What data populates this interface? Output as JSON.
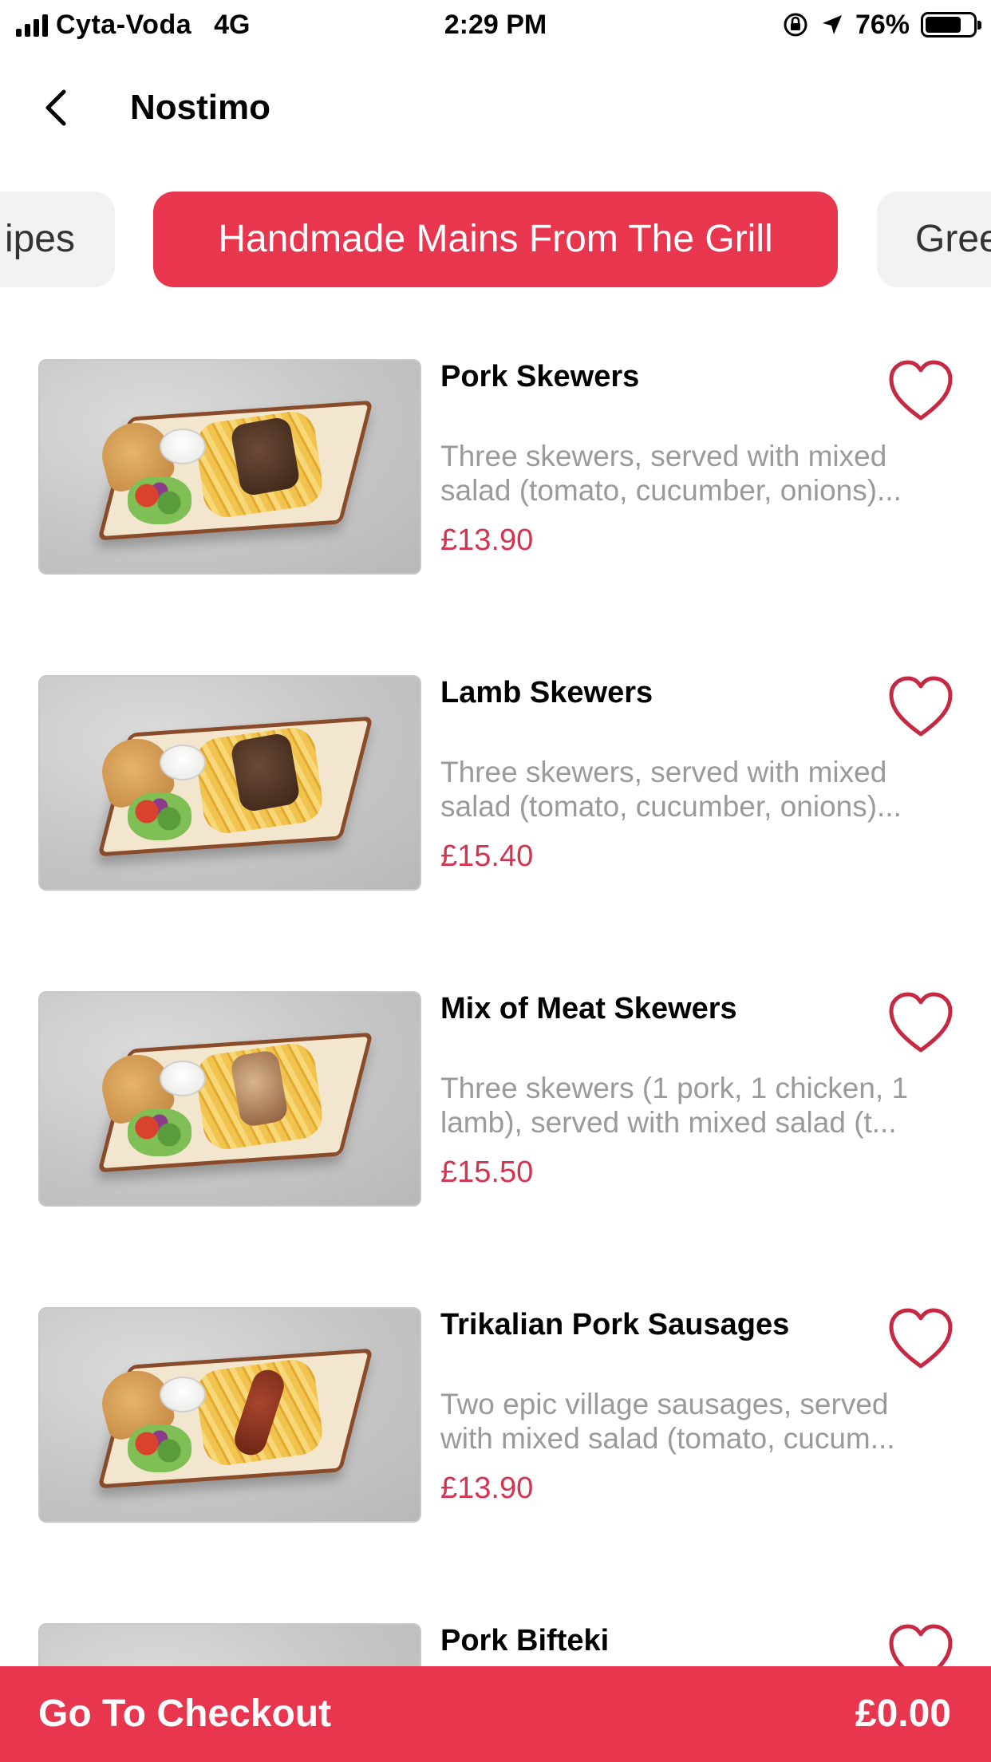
{
  "status_bar": {
    "carrier": "Cyta-Voda",
    "network": "4G",
    "time": "2:29 PM",
    "battery": "76%",
    "battery_level": 0.76
  },
  "header": {
    "title": "Nostimo",
    "back_icon": "chevron-left-icon"
  },
  "categories": {
    "previous_partial": "ipes",
    "active": "Handmade Mains From The Grill",
    "next_partial": "Gree",
    "active_color": "#e8364e"
  },
  "items": [
    {
      "name": "Pork Skewers",
      "desc_line1": "Three skewers, served with mixed",
      "desc_line2": "salad (tomato, cucumber, onions)...",
      "price": "£13.90"
    },
    {
      "name": "Lamb Skewers",
      "desc_line1": "Three skewers, served with mixed",
      "desc_line2": "salad (tomato, cucumber, onions)...",
      "price": "£15.40"
    },
    {
      "name": "Mix of Meat Skewers",
      "desc_line1": "Three skewers (1 pork, 1 chicken, 1",
      "desc_line2": "lamb), served with mixed salad (t...",
      "price": "£15.50"
    },
    {
      "name": "Trikalian Pork Sausages",
      "desc_line1": "Two epic village sausages, served",
      "desc_line2": "with mixed salad (tomato, cucum...",
      "price": "£13.90"
    },
    {
      "name": "Pork Bifteki",
      "desc_line1": "",
      "desc_line2": "",
      "price": ""
    }
  ],
  "checkout": {
    "label": "Go To Checkout",
    "total": "£0.00",
    "color": "#e8364e"
  },
  "colors": {
    "accent": "#e8364e",
    "price": "#d63350",
    "description": "#9a9a9a"
  }
}
